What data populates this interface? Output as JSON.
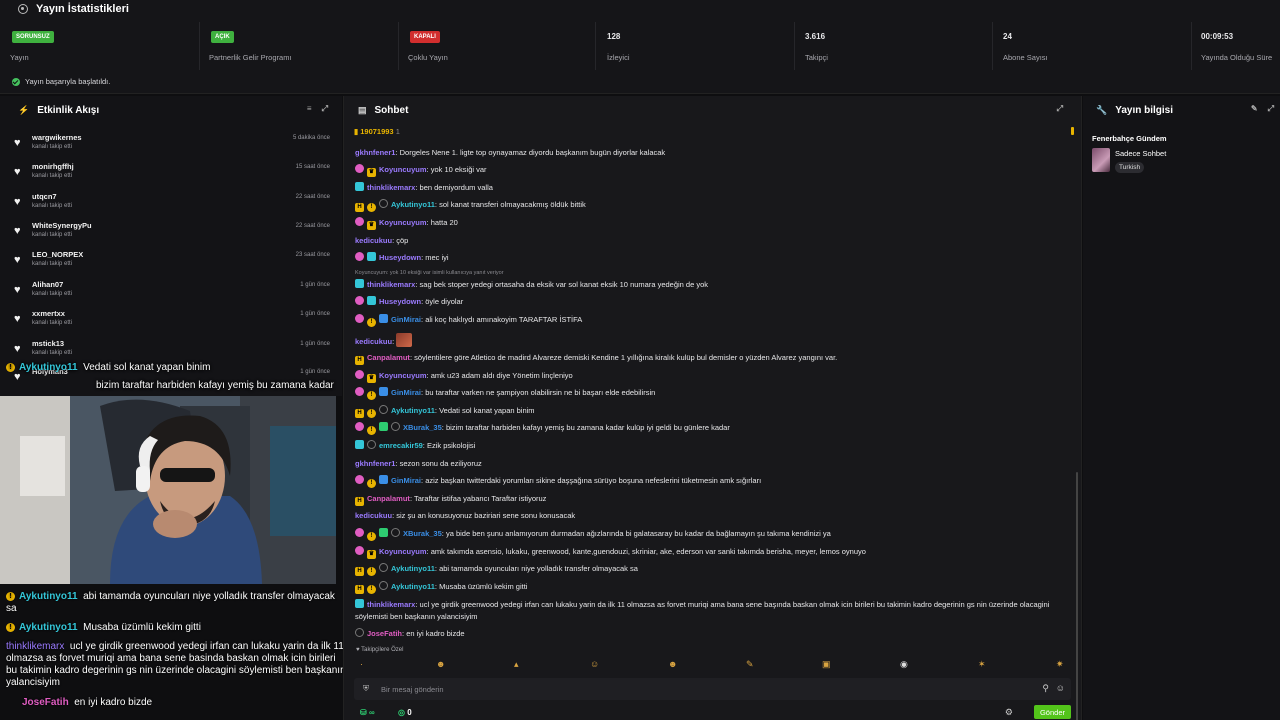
{
  "stats": {
    "title": "Yayın İstatistikleri",
    "cells": [
      {
        "badge": "SORUNSUZ",
        "badge_color": "#3fb13f",
        "label": "Yayın"
      },
      {
        "badge": "AÇIK",
        "badge_color": "#3fb13f",
        "label": "Partnerlik Gelir Programı"
      },
      {
        "badge": "KAPALI",
        "badge_color": "#d12e2e",
        "label": "Çoklu Yayın"
      },
      {
        "value": "128",
        "label": "İzleyici"
      },
      {
        "value": "3.616",
        "label": "Takipçi"
      },
      {
        "value": "24",
        "label": "Abone Sayısı"
      },
      {
        "value": "00:09:53",
        "label": "Yayında Olduğu Süre"
      }
    ],
    "status": "Yayın başarıyla başlatıldı."
  },
  "activity": {
    "title": "Etkinlik Akışı",
    "items": [
      {
        "user": "wargwikernes",
        "action": "kanalı takip etti",
        "time": "5 dakika önce"
      },
      {
        "user": "monirhgffhj",
        "action": "kanalı takip etti",
        "time": "15 saat önce"
      },
      {
        "user": "utqcn7",
        "action": "kanalı takip etti",
        "time": "22 saat önce"
      },
      {
        "user": "WhiteSynergyPu",
        "action": "kanalı takip etti",
        "time": "22 saat önce"
      },
      {
        "user": "LEO_NORPEX",
        "action": "kanalı takip etti",
        "time": "23 saat önce"
      },
      {
        "user": "Alihan07",
        "action": "kanalı takip etti",
        "time": "1 gün önce"
      },
      {
        "user": "xxmertxx",
        "action": "kanalı takip etti",
        "time": "1 gün önce"
      },
      {
        "user": "mstick13",
        "action": "kanalı takip etti",
        "time": "1 gün önce"
      },
      {
        "user": "Holyman3",
        "action": "",
        "time": "1 gün önce"
      }
    ]
  },
  "overlay": {
    "l1_name": "Aykutinyo11",
    "l1_text": "Vedati sol kanat yapan binim",
    "l2_text": "bizim taraftar harbiden kafayı yemiş bu zamana kadar",
    "l3_name": "Aykutinyo11",
    "l3_text": "abi tamamda oyuncuları niye yolladık transfer olmayacak sa",
    "l4_name": "Aykutinyo11",
    "l4_text": "Musaba üzümlü kekim gitti",
    "l5_name": "thinklikemarx",
    "l5_text": "ucl ye girdik greenwood yedegi irfan can lukaku yarin da ilk 11 olmazsa as forvet muriqi ama bana sene basinda baskan olmak icin birileri bu takimin kadro degerinin gs nin üzerinde olacagini söylemisti ben başkanın yalancisiyim",
    "l6_name": "JoseFatih",
    "l6_text": "en iyi kadro bizde"
  },
  "chat": {
    "title": "Sohbet",
    "pinned": "19071993",
    "pinned_count": "1",
    "reply_note": "Koyuncuyum: yok 10 eksiği var isimli kullanıcıya yanıt veriyor",
    "follower_label": "Takipçilere Özel",
    "placeholder": "Bir mesaj gönderin",
    "send_label": "Gönder",
    "points": "∞",
    "points2": "0",
    "messages": [
      {
        "name": "gkhnfener1",
        "color": "#9b7bff",
        "text": "Dorgeles Nene 1. ligte top oynayamaz diyordu başkanım bugün diyorlar kalacak"
      },
      {
        "name": "Koyuncuyum",
        "color": "#9b7bff",
        "text": "yok 10 eksiği var"
      },
      {
        "name": "thinklikemarx",
        "color": "#9b7bff",
        "text": "ben demiyordum valla"
      },
      {
        "name": "Aykutinyo11",
        "color": "#34c6d8",
        "text": "sol kanat transferi olmayacakmış öldük bittik"
      },
      {
        "name": "Koyuncuyum",
        "color": "#9b7bff",
        "text": "hatta 20"
      },
      {
        "name": "kedicukuu",
        "color": "#9b7bff",
        "text": "çöp"
      },
      {
        "name": "Huseydown",
        "color": "#9b7bff",
        "text": "mec iyi"
      },
      {
        "name": "thinklikemarx",
        "color": "#9b7bff",
        "text": "sag bek stoper yedegi ortasaha da eksik var sol kanat eksik 10 numara yedeğin de yok"
      },
      {
        "name": "Huseydown",
        "color": "#9b7bff",
        "text": "öyle diyolar"
      },
      {
        "name": "GinMirai",
        "color": "#3a8ee6",
        "text": "ali koç haklıydı amınakoyim TARAFTAR İSTİFA"
      },
      {
        "name": "kedicukuu",
        "color": "#9b7bff",
        "text": ""
      },
      {
        "name": "Canpalamut",
        "color": "#e05dc2",
        "text": "söylentilere göre Atletico de madird Alvareze demiski Kendine 1 yıllığına kiralık kulüp bul demisler o yüzden Alvarez yangını var."
      },
      {
        "name": "Koyuncuyum",
        "color": "#9b7bff",
        "text": "amk u23 adam aldı diye Yönetim linçleniyo"
      },
      {
        "name": "GinMirai",
        "color": "#3a8ee6",
        "text": "bu taraftar varken ne şampiyon olabilirsin ne bi başarı elde edebilirsin"
      },
      {
        "name": "Aykutinyo11",
        "color": "#34c6d8",
        "text": "Vedati sol kanat yapan binim"
      },
      {
        "name": "XBurak_35",
        "color": "#3a8ee6",
        "text": "bizim taraftar harbiden kafayı yemiş bu zamana kadar kulüp iyi geldi bu günlere kadar"
      },
      {
        "name": "emrecakir59",
        "color": "#34c6d8",
        "text": "Ezik psikolojisi"
      },
      {
        "name": "gkhnfener1",
        "color": "#9b7bff",
        "text": "sezon sonu da eziliyoruz"
      },
      {
        "name": "GinMirai",
        "color": "#3a8ee6",
        "text": "aziz başkan twitterdaki yorumları sikine daşşağına sürüyo boşuna nefeslerini tüketmesin amk sığırları"
      },
      {
        "name": "Canpalamut",
        "color": "#e05dc2",
        "text": "Taraftar istifaa yabancı Taraftar istiyoruz"
      },
      {
        "name": "kedicukuu",
        "color": "#9b7bff",
        "text": "siz şu an konusuyonuz baziriari sene sonu konusacak"
      },
      {
        "name": "XBurak_35",
        "color": "#3a8ee6",
        "text": "ya bide ben şunu anlamıyorum durmadan ağızlarında bi galatasaray bu kadar da bağlamayın şu takıma kendinizi ya"
      },
      {
        "name": "Koyuncuyum",
        "color": "#9b7bff",
        "text": "amk takımda asensio, lukaku, greenwood, kante,guendouzi, skriniar, ake, ederson var sanki takımda berisha, meyer, lemos oynuyo"
      },
      {
        "name": "Aykutinyo11",
        "color": "#34c6d8",
        "text": "abi tamamda oyuncuları niye yolladık transfer olmayacak sa"
      },
      {
        "name": "Aykutinyo11",
        "color": "#34c6d8",
        "text": "Musaba üzümlü kekim gitti"
      },
      {
        "name": "thinklikemarx",
        "color": "#9b7bff",
        "text": "ucl ye girdik greenwood yedegi irfan can lukaku yarin da ilk 11 olmazsa as forvet muriqi ama bana sene başında baskan olmak icin birileri bu takimin kadro degerinin gs nin üzerinde olacagini söylemisti ben başkanın yalancisiyim"
      },
      {
        "name": "JoseFatih",
        "color": "#e05dc2",
        "text": "en iyi kadro bizde"
      }
    ]
  },
  "info": {
    "title": "Yayın bilgisi",
    "category": "Fenerbahçe Gündem",
    "stream_title": "Sadece Sohbet",
    "tag": "Turkish"
  }
}
